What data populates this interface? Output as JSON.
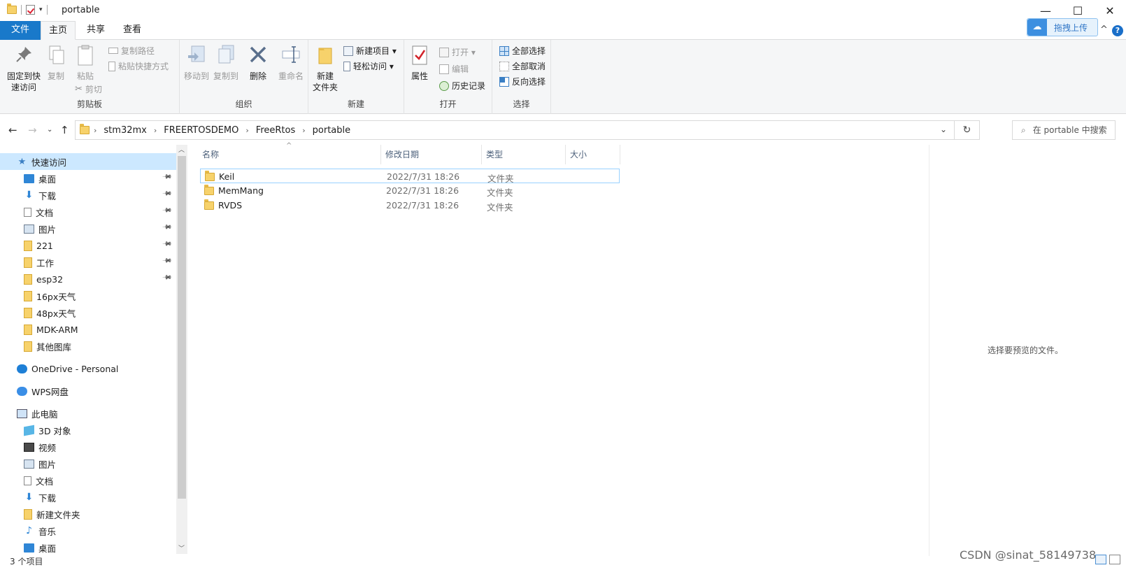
{
  "window": {
    "title": "portable",
    "minimize_icon": "—",
    "maximize_icon": "☐",
    "close_icon": "✕"
  },
  "ribbon_tabs": {
    "file": "文件",
    "home": "主页",
    "share": "共享",
    "view": "查看",
    "upload": "拖拽上传",
    "collapse": "^",
    "help": "?"
  },
  "clipboard": {
    "pin": "固定到快\n速访问",
    "pin_l1": "固定到快",
    "pin_l2": "速访问",
    "copy": "复制",
    "paste": "粘贴",
    "copy_path": "复制路径",
    "paste_shortcut": "粘贴快捷方式",
    "cut": "剪切",
    "label": "剪贴板"
  },
  "organize": {
    "move_to": "移动到",
    "copy_to": "复制到",
    "delete": "删除",
    "rename": "重命名",
    "label": "组织"
  },
  "new_group": {
    "new_folder_l1": "新建",
    "new_folder_l2": "文件夹",
    "new_item": "新建项目 ▾",
    "easy_access": "轻松访问 ▾",
    "label": "新建"
  },
  "open_group": {
    "properties": "属性",
    "open": "打开 ▾",
    "edit": "编辑",
    "history": "历史记录",
    "label": "打开"
  },
  "select_group": {
    "select_all": "全部选择",
    "select_none": "全部取消",
    "invert": "反向选择",
    "label": "选择"
  },
  "address": {
    "crumbs": [
      "stm32mx",
      "FREERTOSDEMO",
      "FreeRtos",
      "portable"
    ],
    "search_placeholder": "在 portable 中搜索"
  },
  "nav": {
    "items": [
      {
        "label": "快速访问",
        "icon": "star-icon",
        "pinned": false
      },
      {
        "label": "桌面",
        "icon": "desktop-icon",
        "pinned": true
      },
      {
        "label": "下载",
        "icon": "download-icon",
        "pinned": true
      },
      {
        "label": "文档",
        "icon": "document-icon",
        "pinned": true
      },
      {
        "label": "图片",
        "icon": "picture-icon",
        "pinned": true
      },
      {
        "label": "221",
        "icon": "folder-icon",
        "pinned": true
      },
      {
        "label": "工作",
        "icon": "folder-icon",
        "pinned": true
      },
      {
        "label": "esp32",
        "icon": "folder-icon",
        "pinned": true
      },
      {
        "label": "16px天气",
        "icon": "folder-icon",
        "pinned": false
      },
      {
        "label": "48px天气",
        "icon": "folder-icon",
        "pinned": false
      },
      {
        "label": "MDK-ARM",
        "icon": "folder-icon",
        "pinned": false
      },
      {
        "label": "其他图库",
        "icon": "folder-icon",
        "pinned": false
      },
      {
        "label": "OneDrive - Personal",
        "icon": "cloud-icon",
        "pinned": false
      },
      {
        "label": "WPS网盘",
        "icon": "wps-cloud-icon",
        "pinned": false
      },
      {
        "label": "此电脑",
        "icon": "computer-icon",
        "pinned": false
      },
      {
        "label": "3D 对象",
        "icon": "cube-icon",
        "pinned": false
      },
      {
        "label": "视频",
        "icon": "video-icon",
        "pinned": false
      },
      {
        "label": "图片",
        "icon": "picture-icon",
        "pinned": false
      },
      {
        "label": "文档",
        "icon": "document-icon",
        "pinned": false
      },
      {
        "label": "下载",
        "icon": "download-icon",
        "pinned": false
      },
      {
        "label": "新建文件夹",
        "icon": "folder-icon",
        "pinned": false
      },
      {
        "label": "音乐",
        "icon": "music-icon",
        "pinned": false
      },
      {
        "label": "桌面",
        "icon": "desktop-icon",
        "pinned": false
      }
    ]
  },
  "columns": {
    "name": "名称",
    "modified": "修改日期",
    "type": "类型",
    "size": "大小"
  },
  "files": [
    {
      "name": "Keil",
      "modified": "2022/7/31 18:26",
      "type": "文件夹",
      "size": ""
    },
    {
      "name": "MemMang",
      "modified": "2022/7/31 18:26",
      "type": "文件夹",
      "size": ""
    },
    {
      "name": "RVDS",
      "modified": "2022/7/31 18:26",
      "type": "文件夹",
      "size": ""
    }
  ],
  "preview_message": "选择要预览的文件。",
  "status_text": "3 个项目",
  "watermark": "CSDN @sinat_58149738",
  "colors": {
    "accent": "#1979ca",
    "selection": "#cce8ff",
    "folder": "#f7d26b"
  }
}
